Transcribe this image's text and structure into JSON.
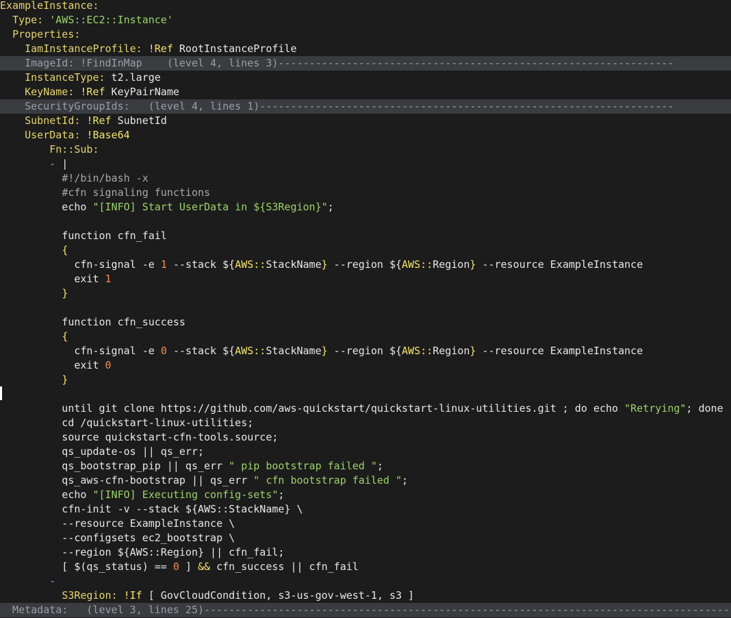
{
  "editor": {
    "lines": [
      {
        "segments": [
          {
            "t": "ExampleInstance:",
            "c": "kk"
          }
        ]
      },
      {
        "segments": [
          {
            "t": "  "
          },
          {
            "t": "Type:",
            "c": "kk"
          },
          {
            "t": " "
          },
          {
            "t": "'AWS::EC2::Instance'",
            "c": "str"
          }
        ]
      },
      {
        "segments": [
          {
            "t": "  "
          },
          {
            "t": "Properties:",
            "c": "kk"
          }
        ]
      },
      {
        "segments": [
          {
            "t": "    "
          },
          {
            "t": "IamInstanceProfile:",
            "c": "kk"
          },
          {
            "t": " "
          },
          {
            "t": "!Ref",
            "c": "bright"
          },
          {
            "t": " RootInstanceProfile"
          }
        ]
      },
      {
        "fold": true,
        "text": "    ImageId: !FindInMap    (level 4, lines 3)",
        "fill": "----------------------------------------------------------------"
      },
      {
        "segments": [
          {
            "t": "    "
          },
          {
            "t": "InstanceType:",
            "c": "kk"
          },
          {
            "t": " t2.large"
          }
        ]
      },
      {
        "segments": [
          {
            "t": "    "
          },
          {
            "t": "KeyName:",
            "c": "kk"
          },
          {
            "t": " "
          },
          {
            "t": "!Ref",
            "c": "bright"
          },
          {
            "t": " KeyPairName"
          }
        ]
      },
      {
        "fold": true,
        "text": "    SecurityGroupIds:   (level 4, lines 1)",
        "fill": "-------------------------------------------------------------------"
      },
      {
        "segments": [
          {
            "t": "    "
          },
          {
            "t": "SubnetId:",
            "c": "kk"
          },
          {
            "t": " "
          },
          {
            "t": "!Ref",
            "c": "bright"
          },
          {
            "t": " SubnetId"
          }
        ]
      },
      {
        "segments": [
          {
            "t": "    "
          },
          {
            "t": "UserData:",
            "c": "kk"
          },
          {
            "t": " "
          },
          {
            "t": "!Base64",
            "c": "bright"
          }
        ]
      },
      {
        "segments": [
          {
            "t": "        "
          },
          {
            "t": "Fn::Sub:",
            "c": "kk"
          }
        ]
      },
      {
        "segments": [
          {
            "t": "        "
          },
          {
            "t": "-",
            "c": "dash"
          },
          {
            "t": " |"
          }
        ]
      },
      {
        "segments": [
          {
            "t": "          "
          },
          {
            "t": "#!/bin/bash -x",
            "c": "cmt"
          }
        ]
      },
      {
        "segments": [
          {
            "t": "          "
          },
          {
            "t": "#cfn signaling functions",
            "c": "cmt"
          }
        ]
      },
      {
        "segments": [
          {
            "t": "          echo "
          },
          {
            "t": "\"[INFO] Start UserData in ${S3Region}\"",
            "c": "str"
          },
          {
            "t": ";"
          }
        ]
      },
      {
        "segments": [
          {
            "t": ""
          }
        ]
      },
      {
        "segments": [
          {
            "t": "          function cfn_fail"
          }
        ]
      },
      {
        "segments": [
          {
            "t": "          "
          },
          {
            "t": "{",
            "c": "bright"
          }
        ]
      },
      {
        "segments": [
          {
            "t": "            cfn-signal -e "
          },
          {
            "t": "1",
            "c": "num"
          },
          {
            "t": " --stack ${"
          },
          {
            "t": "AWS::",
            "c": "bright"
          },
          {
            "t": "StackName"
          },
          {
            "t": "}",
            "c": "bright"
          },
          {
            "t": " --region ${"
          },
          {
            "t": "AWS::",
            "c": "bright"
          },
          {
            "t": "Region"
          },
          {
            "t": "}",
            "c": "bright"
          },
          {
            "t": " --resource ExampleInstance"
          }
        ]
      },
      {
        "segments": [
          {
            "t": "            exit "
          },
          {
            "t": "1",
            "c": "num"
          }
        ]
      },
      {
        "segments": [
          {
            "t": "          "
          },
          {
            "t": "}",
            "c": "bright"
          }
        ]
      },
      {
        "segments": [
          {
            "t": ""
          }
        ]
      },
      {
        "segments": [
          {
            "t": "          function cfn_success"
          }
        ]
      },
      {
        "segments": [
          {
            "t": "          "
          },
          {
            "t": "{",
            "c": "bright"
          }
        ]
      },
      {
        "segments": [
          {
            "t": "            cfn-signal -e "
          },
          {
            "t": "0",
            "c": "num"
          },
          {
            "t": " --stack ${"
          },
          {
            "t": "AWS::",
            "c": "bright"
          },
          {
            "t": "StackName"
          },
          {
            "t": "}",
            "c": "bright"
          },
          {
            "t": " --region ${"
          },
          {
            "t": "AWS::",
            "c": "bright"
          },
          {
            "t": "Region"
          },
          {
            "t": "}",
            "c": "bright"
          },
          {
            "t": " --resource ExampleInstance"
          }
        ]
      },
      {
        "segments": [
          {
            "t": "            exit "
          },
          {
            "t": "0",
            "c": "num"
          }
        ]
      },
      {
        "segments": [
          {
            "t": "          "
          },
          {
            "t": "}",
            "c": "bright"
          }
        ]
      },
      {
        "segments": [
          {
            "t": ""
          }
        ]
      },
      {
        "segments": [
          {
            "t": "          until git clone https://github.com/aws-quickstart/quickstart-linux-utilities.git ; do echo "
          },
          {
            "t": "\"Retrying\"",
            "c": "str"
          },
          {
            "t": "; done"
          }
        ]
      },
      {
        "segments": [
          {
            "t": "          cd /quickstart-linux-utilities;"
          }
        ]
      },
      {
        "segments": [
          {
            "t": "          source quickstart-cfn-tools.source;"
          }
        ]
      },
      {
        "segments": [
          {
            "t": "          qs_update-os || qs_err;"
          }
        ]
      },
      {
        "segments": [
          {
            "t": "          qs_bootstrap_pip || qs_err "
          },
          {
            "t": "\" pip bootstrap failed \"",
            "c": "str"
          },
          {
            "t": ";"
          }
        ]
      },
      {
        "segments": [
          {
            "t": "          qs_aws-cfn-bootstrap || qs_err "
          },
          {
            "t": "\" cfn bootstrap failed \"",
            "c": "str"
          },
          {
            "t": ";"
          }
        ]
      },
      {
        "segments": [
          {
            "t": "          echo "
          },
          {
            "t": "\"[INFO] Executing config-sets\"",
            "c": "str"
          },
          {
            "t": ";"
          }
        ]
      },
      {
        "segments": [
          {
            "t": "          cfn-init -v --stack ${AWS::StackName} \\"
          }
        ]
      },
      {
        "segments": [
          {
            "t": "          --resource ExampleInstance \\"
          }
        ]
      },
      {
        "segments": [
          {
            "t": "          --configsets ec2_bootstrap \\"
          }
        ]
      },
      {
        "segments": [
          {
            "t": "          --region ${AWS::Region} || cfn_fail;"
          }
        ]
      },
      {
        "segments": [
          {
            "t": "          [ $(qs_status) == "
          },
          {
            "t": "0",
            "c": "num"
          },
          {
            "t": " ] "
          },
          {
            "t": "&&",
            "c": "bright"
          },
          {
            "t": " cfn_success || cfn_fail"
          }
        ]
      },
      {
        "segments": [
          {
            "t": "        "
          },
          {
            "t": "-",
            "c": "dash"
          }
        ]
      },
      {
        "segments": [
          {
            "t": "          "
          },
          {
            "t": "S3Region:",
            "c": "kk"
          },
          {
            "t": " "
          },
          {
            "t": "!If",
            "c": "bright"
          },
          {
            "t": " [ GovCloudCondition, s3-us-gov-west-1, s3 ]"
          }
        ]
      },
      {
        "fold": true,
        "text": "  Metadata:   (level 3, lines 25)",
        "fill": "----------------------------------------------------------------------------------------"
      }
    ]
  }
}
